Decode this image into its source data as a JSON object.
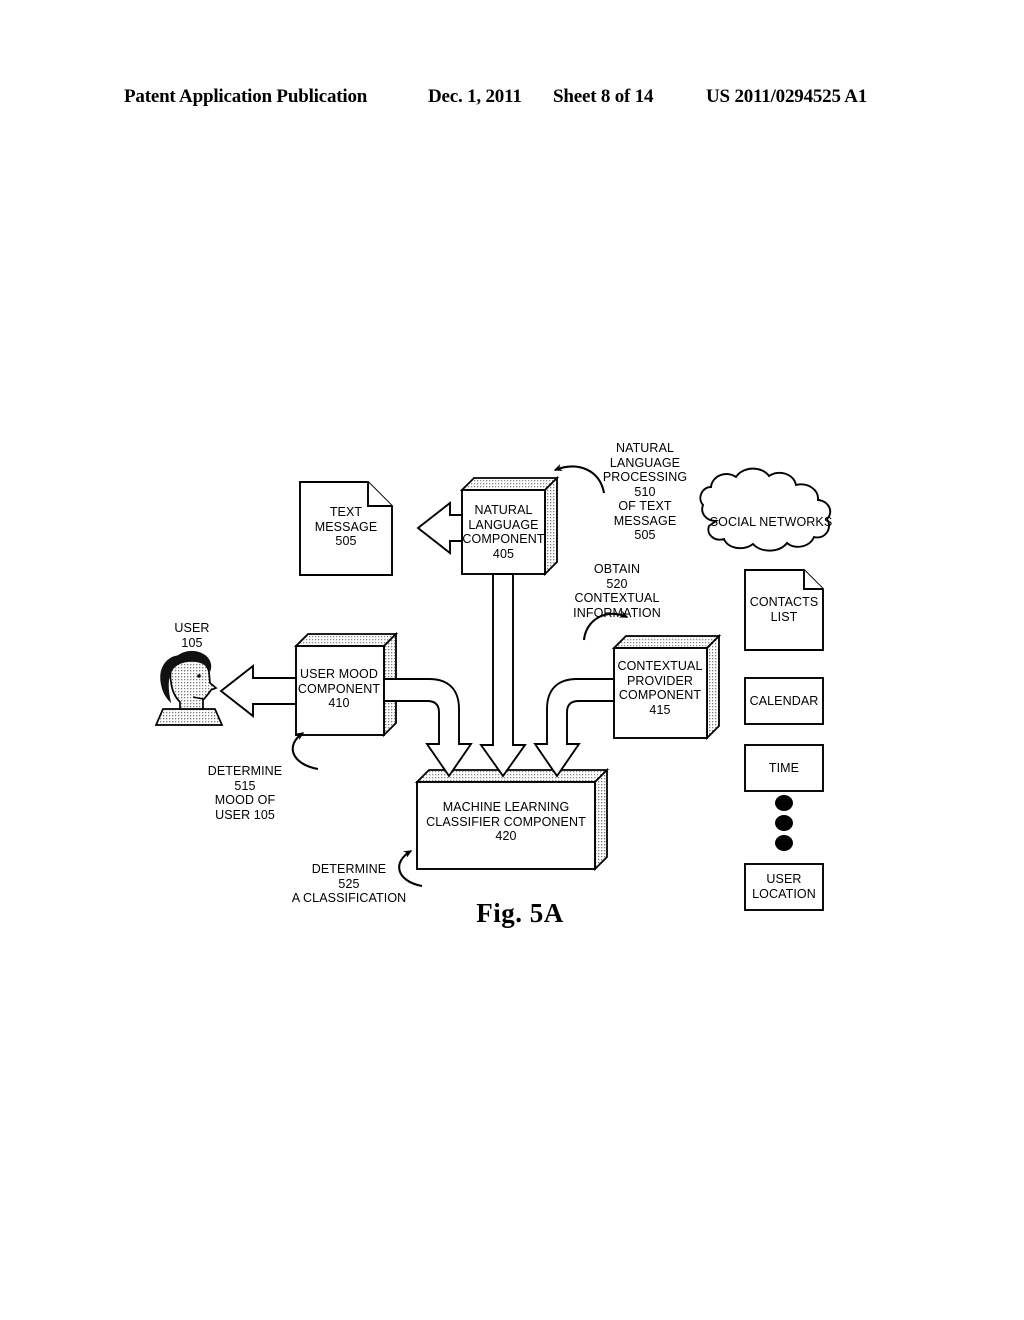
{
  "header": {
    "publication": "Patent Application Publication",
    "date": "Dec. 1, 2011",
    "sheet": "Sheet 8 of 14",
    "number": "US 2011/0294525 A1"
  },
  "figure": {
    "caption": "Fig. 5A",
    "nodes": {
      "text_message": "TEXT\nMESSAGE\n505",
      "natural_language_component": "NATURAL\nLANGUAGE\nCOMPONENT\n405",
      "user_mood_component": "USER MOOD\nCOMPONENT\n410",
      "contextual_provider_component": "CONTEXTUAL\nPROVIDER\nCOMPONENT\n415",
      "machine_learning_classifier_component": "MACHINE LEARNING\nCLASSIFIER COMPONENT\n420",
      "user": "USER\n105",
      "social_networks": "SOCIAL NETWORKS",
      "contacts_list": "CONTACTS\nLIST",
      "calendar": "CALENDAR",
      "time": "TIME",
      "user_location": "USER\nLOCATION"
    },
    "annotations": {
      "nlp_of_text_message": "NATURAL\nLANGUAGE\nPROCESSING\n510\nOF TEXT\nMESSAGE\n505",
      "obtain_contextual_information": "OBTAIN\n520\nCONTEXTUAL\nINFORMATION",
      "determine_mood_of_user": "DETERMINE\n515\nMOOD OF\nUSER 105",
      "determine_a_classification": "DETERMINE\n525\nA CLASSIFICATION"
    }
  },
  "colors": {
    "ink": "#000000",
    "paper": "#ffffff",
    "shade": "#c9c9c9",
    "hair": "#111111",
    "skin": "#d8d8d8"
  }
}
